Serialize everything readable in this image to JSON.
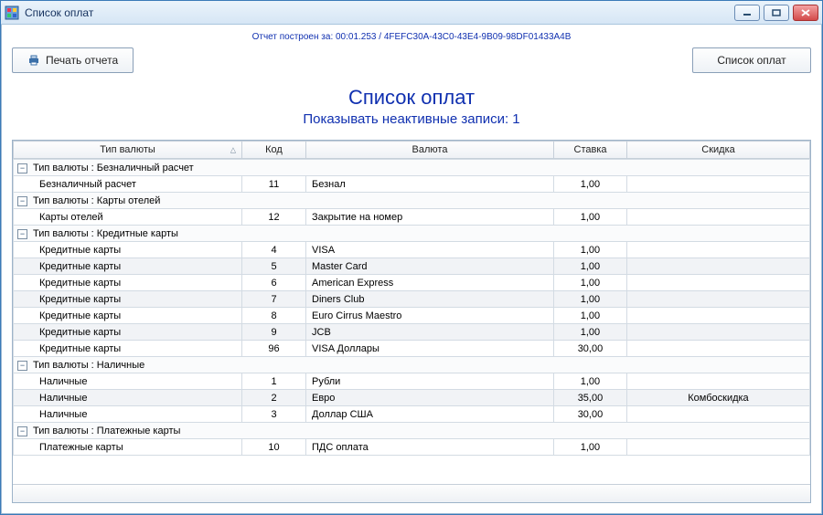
{
  "window": {
    "title": "Список оплат"
  },
  "info_prefix": "Отчет построен за: ",
  "info_time": "00:01.253",
  "info_guid": "4FEFC30A-43C0-43E4-9B09-98DF01433A4B",
  "toolbar": {
    "print_label": "Печать отчета",
    "list_label": "Список оплат"
  },
  "heading": "Список оплат",
  "subheading": "Показывать неактивные записи: 1",
  "columns": {
    "type": "Тип валюты",
    "code": "Код",
    "currency": "Валюта",
    "rate": "Ставка",
    "discount": "Скидка"
  },
  "group_label_prefix": "Тип валюты : ",
  "groups": [
    {
      "name": "Безналичный расчет",
      "rows": [
        {
          "type": "Безналичный расчет",
          "code": "11",
          "currency": "Безнал",
          "rate": "1,00",
          "discount": ""
        }
      ]
    },
    {
      "name": "Карты отелей",
      "rows": [
        {
          "type": "Карты отелей",
          "code": "12",
          "currency": "Закрытие на номер",
          "rate": "1,00",
          "discount": ""
        }
      ]
    },
    {
      "name": "Кредитные карты",
      "rows": [
        {
          "type": "Кредитные карты",
          "code": "4",
          "currency": "VISA",
          "rate": "1,00",
          "discount": ""
        },
        {
          "type": "Кредитные карты",
          "code": "5",
          "currency": "Master Card",
          "rate": "1,00",
          "discount": ""
        },
        {
          "type": "Кредитные карты",
          "code": "6",
          "currency": "American Express",
          "rate": "1,00",
          "discount": ""
        },
        {
          "type": "Кредитные карты",
          "code": "7",
          "currency": "Diners Club",
          "rate": "1,00",
          "discount": ""
        },
        {
          "type": "Кредитные карты",
          "code": "8",
          "currency": "Euro Cirrus Maestro",
          "rate": "1,00",
          "discount": ""
        },
        {
          "type": "Кредитные карты",
          "code": "9",
          "currency": "JCB",
          "rate": "1,00",
          "discount": ""
        },
        {
          "type": "Кредитные карты",
          "code": "96",
          "currency": "VISA Доллары",
          "rate": "30,00",
          "discount": ""
        }
      ]
    },
    {
      "name": "Наличные",
      "rows": [
        {
          "type": "Наличные",
          "code": "1",
          "currency": "Рубли",
          "rate": "1,00",
          "discount": ""
        },
        {
          "type": "Наличные",
          "code": "2",
          "currency": "Евро",
          "rate": "35,00",
          "discount": "Комбоскидка"
        },
        {
          "type": "Наличные",
          "code": "3",
          "currency": "Доллар США",
          "rate": "30,00",
          "discount": ""
        }
      ]
    },
    {
      "name": "Платежные карты",
      "rows": [
        {
          "type": "Платежные карты",
          "code": "10",
          "currency": "ПДС оплата",
          "rate": "1,00",
          "discount": ""
        }
      ]
    }
  ]
}
